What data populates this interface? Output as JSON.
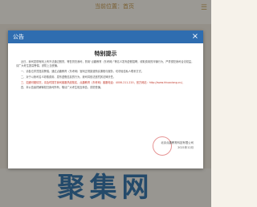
{
  "background": {
    "site_logo": "当前位置：首页",
    "menu_icon": "menu-icon",
    "watermark_text": "聚集网"
  },
  "modal": {
    "title": "公告",
    "close_label": "×",
    "heading": "特别提示",
    "paragraphs": [
      "近日，我司发现有网上有不法通过假冒，等售冒充我司，冒用“点趣教育（东考网）”等名义发布虚假招聘，收取费用的诈骗行为，严重侵犯我司合法权益，请广大考生提高警惕，谨防上当受骗。",
      "一、请各位学员提高警惕，通过点趣教育（东考网）官网正规渠道购买课程与服务，切勿轻信私人联系方式。",
      "二、对于以我司名义收取费用、发布虚假信息的行为，我司将依法追究其法律责任。",
      "三、如遇可疑情况，请及时拨打我司客服热线核实，点趣教育（东考网）客服电话：4006-211-220，官方网站：http://www.hhuaxiang.cn/。",
      "四、本公告最终解释权归我司所有，敬请广大考生相互转告，谨防受骗。"
    ],
    "signature_company": "北京点趣教育科技有限公司",
    "signature_date": "2021年12月"
  }
}
